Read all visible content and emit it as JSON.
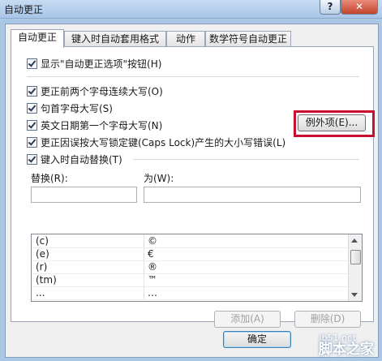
{
  "window": {
    "title": "自动更正",
    "help_label": "?",
    "close_label": "✕"
  },
  "tabs": [
    {
      "label": "自动更正",
      "active": true
    },
    {
      "label": "键入时自动套用格式",
      "active": false
    },
    {
      "label": "动作",
      "active": false
    },
    {
      "label": "数学符号自动更正",
      "active": false
    }
  ],
  "options": {
    "show_buttons": {
      "label": "显示\"自动更正选项\"按钮(H)",
      "checked": true
    },
    "correct_two_initial": {
      "label": "更正前两个字母连续大写(O)",
      "checked": true
    },
    "capitalize_first": {
      "label": "句首字母大写(S)",
      "checked": true
    },
    "capitalize_days": {
      "label": "英文日期第一个字母大写(N)",
      "checked": true
    },
    "caps_lock": {
      "label": "更正因误按大写锁定键(Caps Lock)产生的大小写错误(L)",
      "checked": true
    },
    "replace_typing": {
      "label": "键入时自动替换(T)",
      "checked": true
    }
  },
  "exceptions_button": "例外项(E)...",
  "replace": {
    "replace_label": "替换(R):",
    "with_label": "为(W):",
    "replace_value": "",
    "with_value": ""
  },
  "list": {
    "rows": [
      {
        "from": "(c)",
        "to": "©"
      },
      {
        "from": "(e)",
        "to": "€"
      },
      {
        "from": "(r)",
        "to": "®"
      },
      {
        "from": "(tm)",
        "to": "™"
      },
      {
        "from": "...",
        "to": "…"
      }
    ]
  },
  "buttons": {
    "add": "添加(A)",
    "delete": "删除(D)",
    "ok": "确定"
  },
  "watermark": {
    "site": "jb51.net",
    "name": "脚本之家"
  }
}
